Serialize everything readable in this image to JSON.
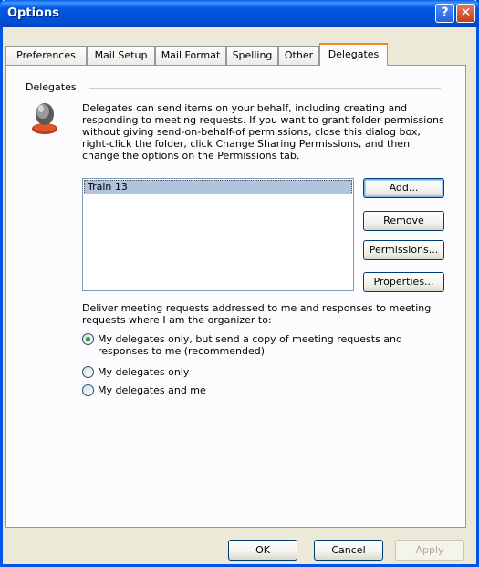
{
  "window": {
    "title": "Options",
    "help_glyph": "?",
    "close_glyph": "✕"
  },
  "tabs": [
    {
      "label": "Preferences"
    },
    {
      "label": "Mail Setup"
    },
    {
      "label": "Mail Format"
    },
    {
      "label": "Spelling"
    },
    {
      "label": "Other"
    },
    {
      "label": "Delegates",
      "active": true
    }
  ],
  "delegates": {
    "group_label": "Delegates",
    "description": "Delegates can send items on your behalf, including creating and responding to meeting requests. If you want to grant folder permissions without giving send-on-behalf-of permissions, close this dialog box, right-click the folder, click Change Sharing Permissions, and then change the options on the Permissions tab.",
    "list_items": [
      "Train 13"
    ],
    "buttons": {
      "add": "Add...",
      "remove": "Remove",
      "permissions": "Permissions...",
      "properties": "Properties..."
    },
    "deliver_label": "Deliver meeting requests addressed to me and responses to meeting requests where I am the organizer to:",
    "options": [
      {
        "label": "My delegates only, but send a copy of meeting requests and responses to me (recommended)",
        "selected": true
      },
      {
        "label": "My delegates only",
        "selected": false
      },
      {
        "label": "My delegates and me",
        "selected": false
      }
    ]
  },
  "footer": {
    "ok": "OK",
    "cancel": "Cancel",
    "apply": "Apply"
  },
  "colors": {
    "titlebar": "#0054E3",
    "dialog_bg": "#ECE9D8",
    "active_tab_accent": "#E68B2C",
    "selection": "#B0C4DE",
    "radio_dot": "#21A121"
  }
}
